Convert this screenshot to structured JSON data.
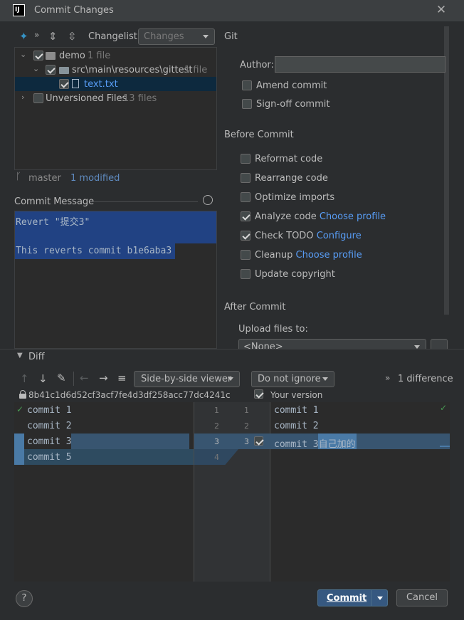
{
  "window": {
    "title": "Commit Changes",
    "logo_text": "IJ"
  },
  "changelist": {
    "label": "Changelist:",
    "value": "Changes"
  },
  "tree": {
    "root": {
      "name": "demo",
      "meta": "1 file"
    },
    "folder": {
      "name": "src\\main\\resources\\gittest",
      "meta": "1 file"
    },
    "file": {
      "name": "text.txt"
    },
    "unversioned": {
      "name": "Unversioned Files",
      "meta": "13 files"
    }
  },
  "status": {
    "branch": "master",
    "modified": "1 modified"
  },
  "commit_message": {
    "label": "Commit Message",
    "lines": [
      "Revert \"提交3\"",
      "",
      "This reverts commit b1e6aba3"
    ]
  },
  "git": {
    "section": "Git",
    "author_label": "Author:",
    "author_value": "",
    "amend": "Amend commit",
    "signoff": "Sign-off commit"
  },
  "before_commit": {
    "section": "Before Commit",
    "reformat": "Reformat code",
    "rearrange": "Rearrange code",
    "optimize": "Optimize imports",
    "analyze": "Analyze code",
    "analyze_link": "Choose profile",
    "todo": "Check TODO",
    "todo_link": "Configure",
    "cleanup": "Cleanup",
    "cleanup_link": "Choose profile",
    "copyright": "Update copyright"
  },
  "after_commit": {
    "section": "After Commit",
    "upload_label": "Upload files to:",
    "upload_value": "<None>"
  },
  "diff": {
    "label": "Diff",
    "viewer": "Side-by-side viewer",
    "ignore": "Do not ignore",
    "count": "1 difference",
    "hash": "8b41c1d6d52cf3acf7fe4d3df258acc77dc4241c",
    "your_version": "Your version",
    "left_lines": [
      "commit 1",
      "commit 2",
      "commit 3",
      "commit 5"
    ],
    "left_numbers": [
      "1",
      "2",
      "3",
      "4"
    ],
    "right_numbers": [
      "1",
      "2",
      "3"
    ],
    "right_lines": [
      "commit 1",
      "commit 2",
      "commit 3自己加的"
    ]
  },
  "buttons": {
    "help": "?",
    "commit": "Commit",
    "cancel": "Cancel"
  },
  "colors": {
    "accent": "#365880",
    "selection": "#214283",
    "link": "#589df6",
    "ok_green": "#499c54"
  }
}
